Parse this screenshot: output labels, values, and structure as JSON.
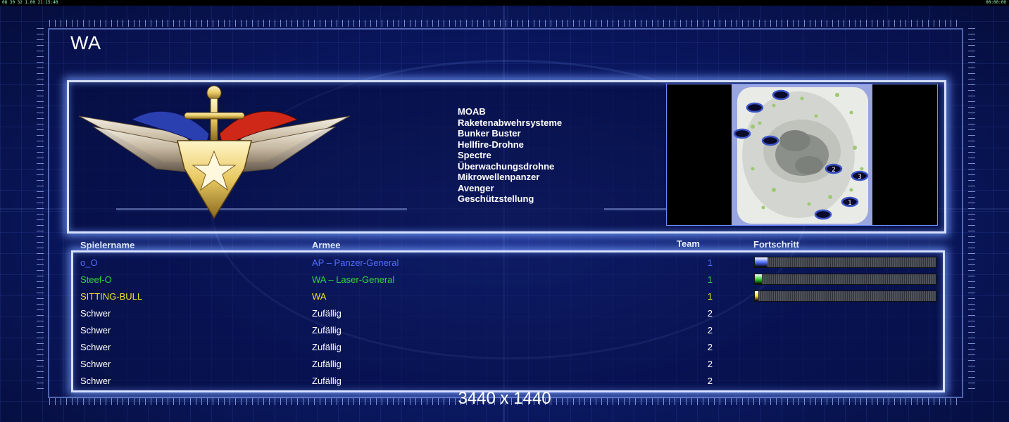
{
  "topbar": {
    "left": "08 30 32 1.00 21:15:40",
    "right": "00:00:00"
  },
  "title": "WA",
  "powers": [
    "MOAB",
    "Raketenabwehrsysteme",
    "Bunker Buster",
    "Hellfire-Drohne",
    "Spectre",
    "Überwachungsdrohne",
    "Mikrowellenpanzer",
    "Avenger",
    "Geschützstellung"
  ],
  "map": {
    "start_labels": [
      "2",
      "3",
      "1"
    ]
  },
  "columns": {
    "name": "Spielername",
    "army": "Armee",
    "team": "Team",
    "progress": "Fortschritt"
  },
  "players": [
    {
      "name": "o_O",
      "army": "AP – Panzer-General",
      "team": "1",
      "color": "#4f6cff",
      "progress": 0.07
    },
    {
      "name": "Steef-O",
      "army": "WA – Laser-General",
      "team": "1",
      "color": "#33d63a",
      "progress": 0.04
    },
    {
      "name": "SITTING-BULL",
      "army": "WA",
      "team": "1",
      "color": "#f2e21e",
      "progress": 0.02
    },
    {
      "name": "Schwer",
      "army": "Zufällig",
      "team": "2",
      "color": "#ffffff"
    },
    {
      "name": "Schwer",
      "army": "Zufällig",
      "team": "2",
      "color": "#ffffff"
    },
    {
      "name": "Schwer",
      "army": "Zufällig",
      "team": "2",
      "color": "#ffffff"
    },
    {
      "name": "Schwer",
      "army": "Zufällig",
      "team": "2",
      "color": "#ffffff"
    },
    {
      "name": "Schwer",
      "army": "Zufällig",
      "team": "2",
      "color": "#ffffff"
    }
  ],
  "resolution": "3440 x 1440"
}
